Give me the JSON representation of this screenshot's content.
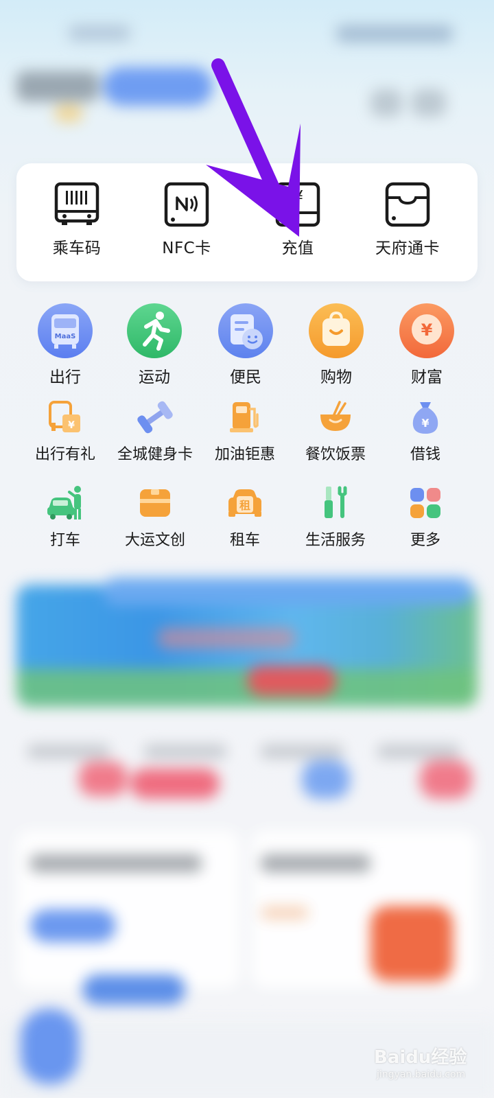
{
  "top_card": {
    "items": [
      {
        "label": "乘车码",
        "icon": "bus-code-icon"
      },
      {
        "label": "NFC卡",
        "icon": "nfc-card-icon"
      },
      {
        "label": "充值",
        "icon": "recharge-icon"
      },
      {
        "label": "天府通卡",
        "icon": "card-wallet-icon"
      }
    ]
  },
  "categories": [
    {
      "label": "出行",
      "icon": "maas-bus-icon",
      "color": "#6f8ff1"
    },
    {
      "label": "运动",
      "icon": "running-icon",
      "color": "#3fc878"
    },
    {
      "label": "便民",
      "icon": "service-doc-icon",
      "color": "#6c90f0"
    },
    {
      "label": "购物",
      "icon": "shopping-bag-icon",
      "color": "#f8a83a"
    },
    {
      "label": "财富",
      "icon": "yuan-coin-icon",
      "color": "#f5743f"
    }
  ],
  "services_row1": [
    {
      "label": "出行有礼",
      "icon": "travel-gift-icon"
    },
    {
      "label": "全城健身卡",
      "icon": "dumbbell-icon"
    },
    {
      "label": "加油钜惠",
      "icon": "fuel-pump-icon"
    },
    {
      "label": "餐饮饭票",
      "icon": "food-bowl-icon"
    },
    {
      "label": "借钱",
      "icon": "money-bag-icon"
    }
  ],
  "services_row2": [
    {
      "label": "打车",
      "icon": "taxi-icon"
    },
    {
      "label": "大运文创",
      "icon": "gift-box-icon"
    },
    {
      "label": "租车",
      "icon": "car-rental-icon",
      "badge": "租"
    },
    {
      "label": "生活服务",
      "icon": "tools-icon"
    },
    {
      "label": "更多",
      "icon": "more-grid-icon"
    }
  ],
  "coin_symbol": "¥",
  "maas_text": "MaaS",
  "watermark": {
    "text": "Baidu经验",
    "sub": "jingyan.baidu.com"
  },
  "accent_colors": {
    "arrow": "#7a12e8",
    "icon_orange": "#f5a23a",
    "icon_blue": "#6d8ff0",
    "icon_green": "#45c47e"
  }
}
